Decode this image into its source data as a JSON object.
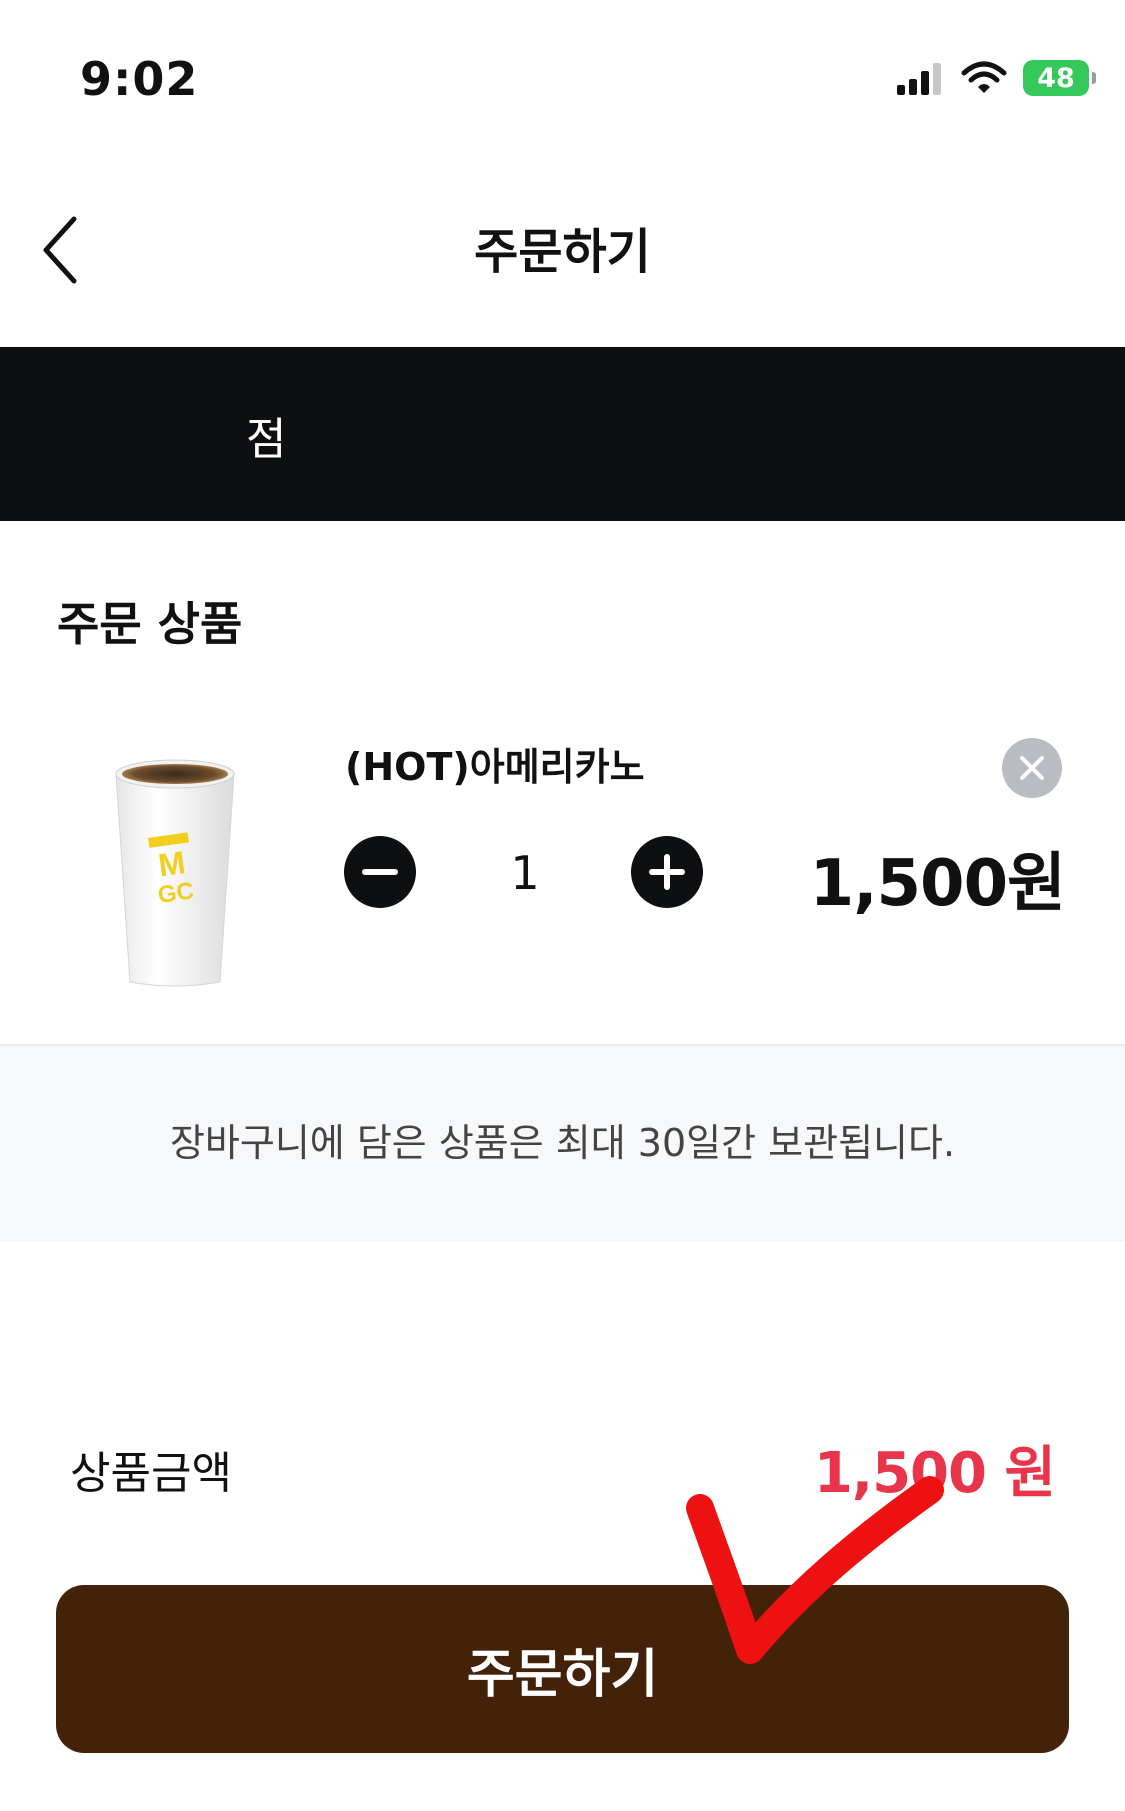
{
  "status_bar": {
    "time": "9:02",
    "battery": "48"
  },
  "nav": {
    "title": "주문하기",
    "back_icon": "chevron-left-icon"
  },
  "store": {
    "name": "점"
  },
  "order_items": {
    "section_title": "주문 상품",
    "items": [
      {
        "name": "(HOT)아메리카노",
        "quantity": "1",
        "price": "1,500원",
        "image": "coffee-cup"
      }
    ]
  },
  "notice": {
    "text": "장바구니에 담은 상품은 최대 30일간 보관됩니다."
  },
  "summary": {
    "label": "상품금액",
    "total": "1,500 원"
  },
  "order_button": {
    "label": "주문하기"
  },
  "colors": {
    "banner": "#0e0f11",
    "order_button": "#44220a",
    "total_price": "#e8354b",
    "battery": "#34c759",
    "annotation": "#ee1111"
  },
  "annotation": {
    "icon": "red-checkmark"
  }
}
